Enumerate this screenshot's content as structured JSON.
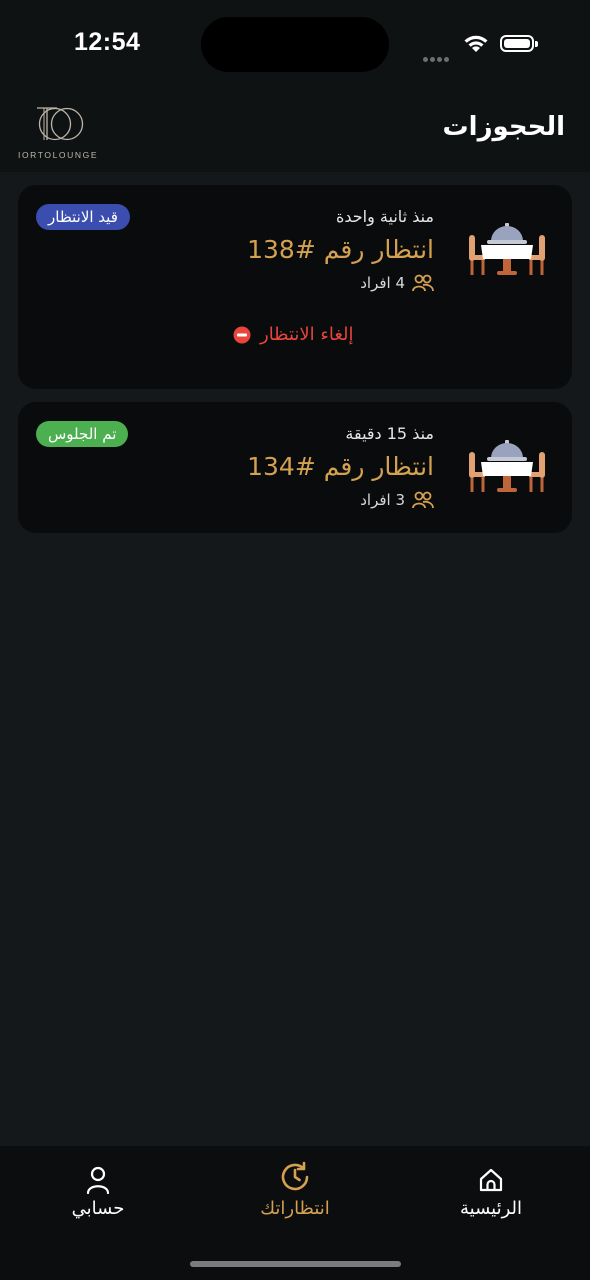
{
  "status_bar": {
    "time": "12:54"
  },
  "header": {
    "title": "الحجوزات",
    "logo_text": "IORTOLOUNGE"
  },
  "reservations": [
    {
      "time_ago": "منذ ثانية واحدة",
      "title": "انتظار رقم #138",
      "party_size": "4 افراد",
      "status": "قيد الانتظار",
      "status_color": "#3b4eb0",
      "cancel_label": "إلغاء الانتظار"
    },
    {
      "time_ago": "منذ 15 دقيقة",
      "title": "انتظار رقم #134",
      "party_size": "3 افراد",
      "status": "تم الجلوس",
      "status_color": "#4caf50"
    }
  ],
  "tab_bar": {
    "home_label": "الرئيسية",
    "queue_label": "انتظاراتك",
    "account_label": "حسابي",
    "active": "queue",
    "active_color": "#d4a150"
  }
}
